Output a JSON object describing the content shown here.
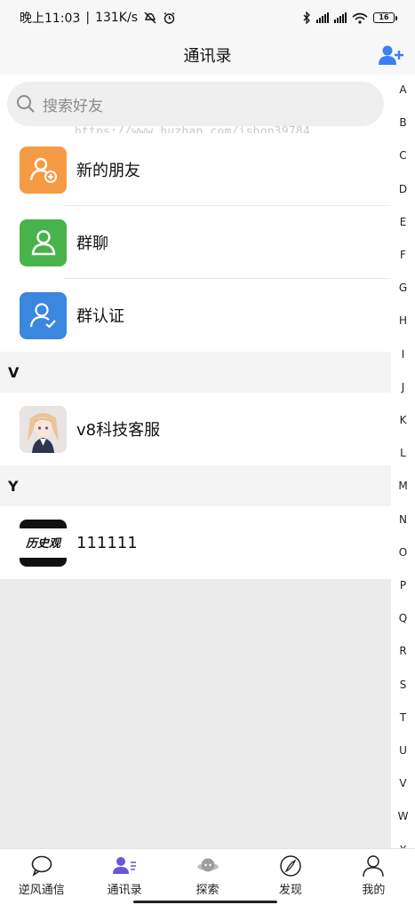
{
  "status_bar": {
    "time": "晚上11:03",
    "network_speed": "131K/s",
    "battery_level": "16"
  },
  "header": {
    "title": "通讯录",
    "add_friend_icon": "person-add-icon",
    "accent_color": "#3b7ff3"
  },
  "search": {
    "placeholder": "搜索好友"
  },
  "watermark": "https://www.huzhan.com/ishop39784",
  "shortcuts": [
    {
      "label": "新的朋友",
      "icon": "new-friend-icon",
      "color": "#f59a45"
    },
    {
      "label": "群聊",
      "icon": "group-chat-icon",
      "color": "#48b34a"
    },
    {
      "label": "群认证",
      "icon": "group-verify-icon",
      "color": "#3a87e0"
    }
  ],
  "sections": [
    {
      "letter": "V",
      "contacts": [
        {
          "name": "v8科技客服",
          "avatar": "anime-girl-avatar"
        }
      ]
    },
    {
      "letter": "Y",
      "contacts": [
        {
          "name": "111111",
          "avatar": "calligraphy-avatar",
          "avatar_text": "历史观"
        }
      ]
    }
  ],
  "index_letters": [
    "A",
    "B",
    "C",
    "D",
    "E",
    "F",
    "G",
    "H",
    "I",
    "J",
    "K",
    "L",
    "M",
    "N",
    "O",
    "P",
    "Q",
    "R",
    "S",
    "T",
    "U",
    "V",
    "W",
    "X"
  ],
  "tabs": [
    {
      "label": "逆风通信",
      "icon": "chat-bubble-icon",
      "active": false
    },
    {
      "label": "通讯录",
      "icon": "contacts-icon",
      "active": true
    },
    {
      "label": "探索",
      "icon": "explore-planet-icon",
      "active": false
    },
    {
      "label": "发现",
      "icon": "compass-icon",
      "active": false
    },
    {
      "label": "我的",
      "icon": "profile-icon",
      "active": false
    }
  ]
}
